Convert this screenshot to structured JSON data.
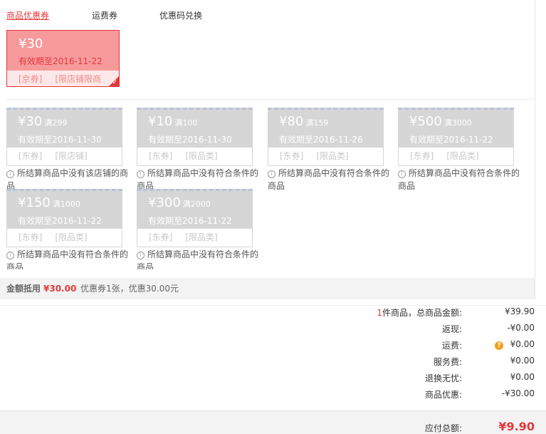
{
  "tabs": [
    "商品优惠券",
    "运费券",
    "优惠码兑换"
  ],
  "selected_coupon": {
    "amount": "¥30",
    "expiry": "有效期至2016-11-22",
    "tags": [
      "[京券]",
      "[限店铺限商品]"
    ]
  },
  "unavailable_coupons": [
    {
      "amount": "¥30",
      "condition": "满299",
      "expiry": "有效期至2016-11-30",
      "tags": [
        "[东券]",
        "[限店铺]"
      ],
      "reason": "所结算商品中没有该店铺的商品"
    },
    {
      "amount": "¥10",
      "condition": "满100",
      "expiry": "有效期至2016-11-30",
      "tags": [
        "[东券]",
        "[限品类]"
      ],
      "reason": "所结算商品中没有符合条件的商品"
    },
    {
      "amount": "¥80",
      "condition": "满159",
      "expiry": "有效期至2016-11-26",
      "tags": [
        "[东券]",
        "[限品类]"
      ],
      "reason": "所结算商品中没有符合条件的商品"
    },
    {
      "amount": "¥500",
      "condition": "满3000",
      "expiry": "有效期至2016-11-22",
      "tags": [
        "[东券]",
        "[限品类]"
      ],
      "reason": "所结算商品中没有符合条件的商品"
    },
    {
      "amount": "¥150",
      "condition": "满1000",
      "expiry": "有效期至2016-11-22",
      "tags": [
        "[东券]",
        "[限品类]"
      ],
      "reason": "所结算商品中没有符合条件的商品"
    },
    {
      "amount": "¥300",
      "condition": "满2000",
      "expiry": "有效期至2016-11-22",
      "tags": [
        "[东券]",
        "[限品类]"
      ],
      "reason": "所结算商品中没有符合条件的商品"
    }
  ],
  "summary": {
    "label": "金额抵用",
    "amount": "¥30.00",
    "desc": "优惠券1张，优惠30.00元"
  },
  "fees": {
    "count": "1",
    "items": [
      {
        "label": "件商品，总商品金额:",
        "value": "¥39.90"
      },
      {
        "label": "返现:",
        "value": "-¥0.00"
      },
      {
        "label": "运费:",
        "value": "¥0.00"
      },
      {
        "label": "服务费:",
        "value": "¥0.00"
      },
      {
        "label": "退换无忧:",
        "value": "¥0.00"
      },
      {
        "label": "商品优惠:",
        "value": "-¥30.00"
      }
    ]
  },
  "total": {
    "label": "应付总额:",
    "value": "¥9.90"
  },
  "colors": {
    "accent": "#e4393c",
    "selected_bg": "#f69a9c",
    "disabled": "#d6d6d6"
  }
}
